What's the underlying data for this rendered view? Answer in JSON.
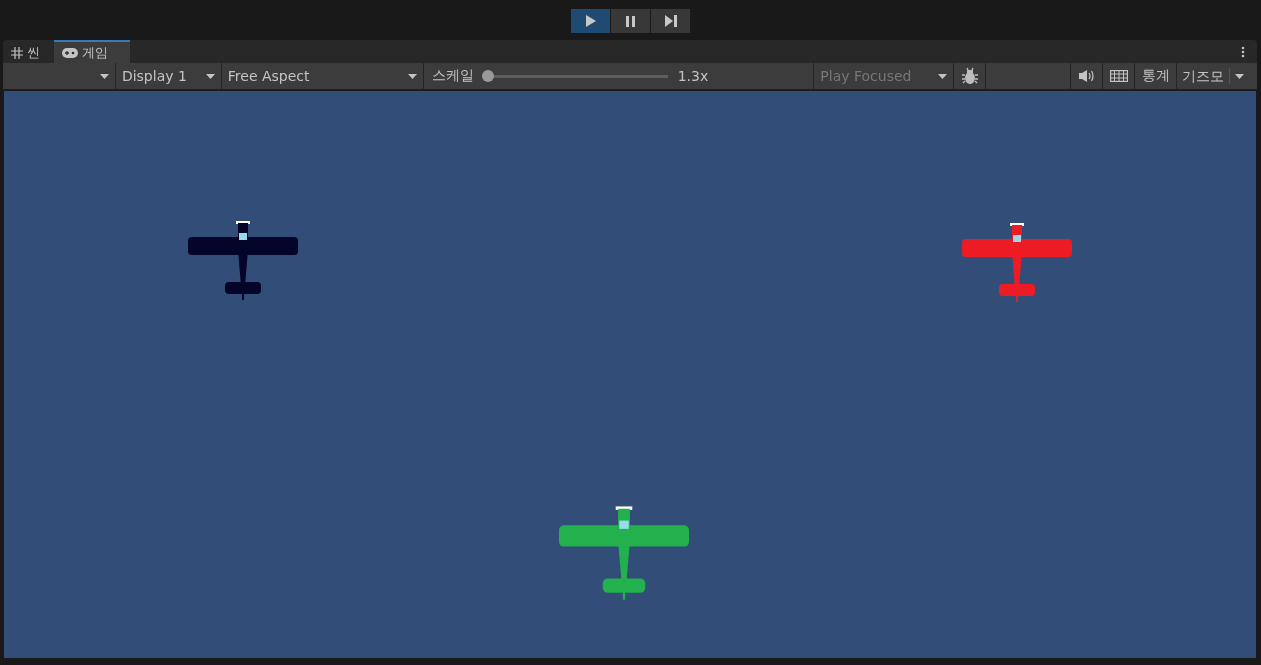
{
  "play_controls": [
    {
      "kind": "play",
      "selected": true
    },
    {
      "kind": "pause",
      "selected": false
    },
    {
      "kind": "step",
      "selected": false
    }
  ],
  "tabs": [
    {
      "kind": "scene",
      "label": "씬",
      "selected": false
    },
    {
      "kind": "game",
      "label": "게임",
      "selected": true
    }
  ],
  "toolbar": {
    "display": "Display 1",
    "aspect": "Free Aspect",
    "scale_label": "스케일",
    "scale": {
      "level": 0
    },
    "scale_reading": "1.3x",
    "play_mode": {
      "label": "Play Focused",
      "disabled": true
    },
    "stats": "통계",
    "gizmos": "기즈모"
  },
  "planes": [
    {
      "color": "#05052a"
    },
    {
      "color": "#ed1c24"
    },
    {
      "color": "#22b14c"
    }
  ]
}
